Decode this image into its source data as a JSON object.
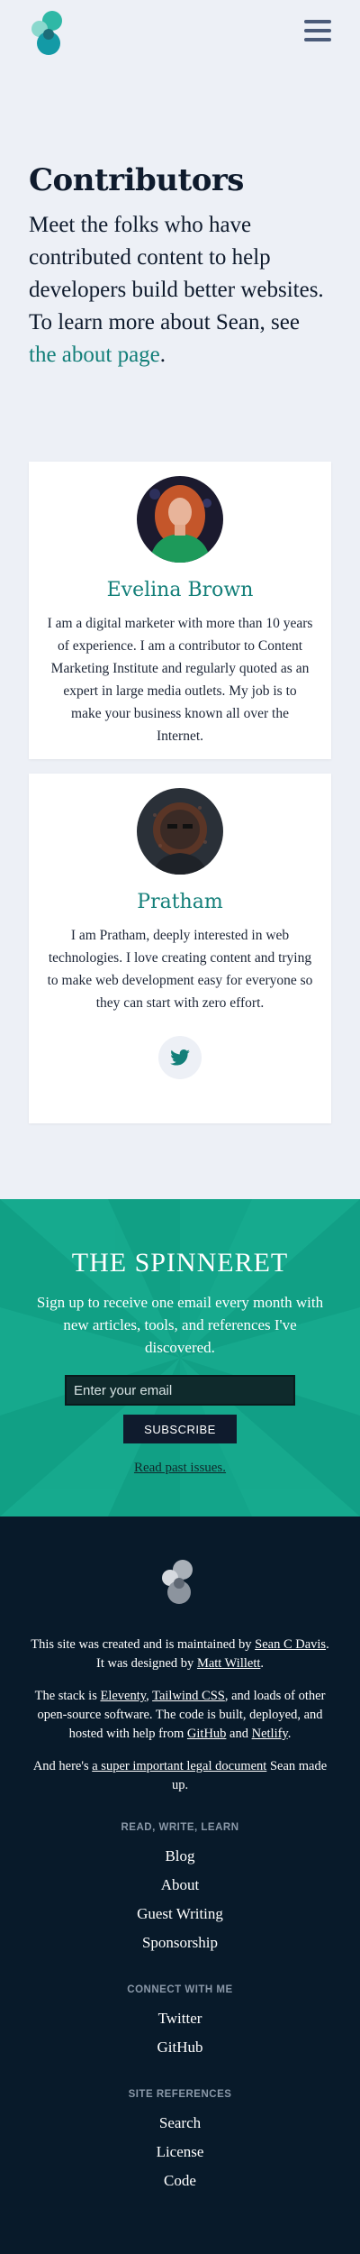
{
  "intro": {
    "title": "Contributors",
    "text": "Meet the folks who have contributed content to help developers build better websites. To learn more about Sean, see ",
    "link_text": "the about page",
    "suffix": "."
  },
  "contributors": [
    {
      "name": "Evelina Brown",
      "bio": "I am a digital marketer with more than 10 years of experience. I am a contributor to Content Marketing Institute and regularly quoted as an expert in large media outlets. My job is to make your business known all over the Internet."
    },
    {
      "name": "Pratham",
      "bio": "I am Pratham, deeply interested in web technologies. I love creating content and trying to make web development easy for everyone so they can start with zero effort."
    }
  ],
  "newsletter": {
    "title": "THE SPINNERET",
    "subtitle": "Sign up to receive one email every month with new articles, tools, and references I've discovered.",
    "placeholder": "Enter your email",
    "button": "SUBSCRIBE",
    "past_link": "Read past issues."
  },
  "footer": {
    "p1_a": "This site was created and is maintained by ",
    "p1_link1": "Sean C Davis",
    "p1_b": ". It was designed by ",
    "p1_link2": "Matt Willett",
    "p1_c": ".",
    "p2_a": "The stack is ",
    "p2_link1": "Eleventy",
    "p2_b": ", ",
    "p2_link2": "Tailwind CSS",
    "p2_c": ", and loads of other open-source software. The code is built, deployed, and hosted with help from ",
    "p2_link3": "GitHub",
    "p2_d": " and ",
    "p2_link4": "Netlify",
    "p2_e": ".",
    "p3_a": "And here's ",
    "p3_link": "a super important legal document",
    "p3_b": " Sean made up.",
    "sections": [
      {
        "heading": "READ, WRITE, LEARN",
        "links": [
          "Blog",
          "About",
          "Guest Writing",
          "Sponsorship"
        ]
      },
      {
        "heading": "CONNECT WITH ME",
        "links": [
          "Twitter",
          "GitHub"
        ]
      },
      {
        "heading": "SITE REFERENCES",
        "links": [
          "Search",
          "License",
          "Code"
        ]
      }
    ]
  },
  "icons": {
    "logo": "sean-logo-icon",
    "menu": "hamburger-menu-icon",
    "twitter": "twitter-icon"
  },
  "colors": {
    "accent": "#137f79",
    "newsletter_bg": "#13a58a",
    "footer_bg": "#081a2a"
  }
}
